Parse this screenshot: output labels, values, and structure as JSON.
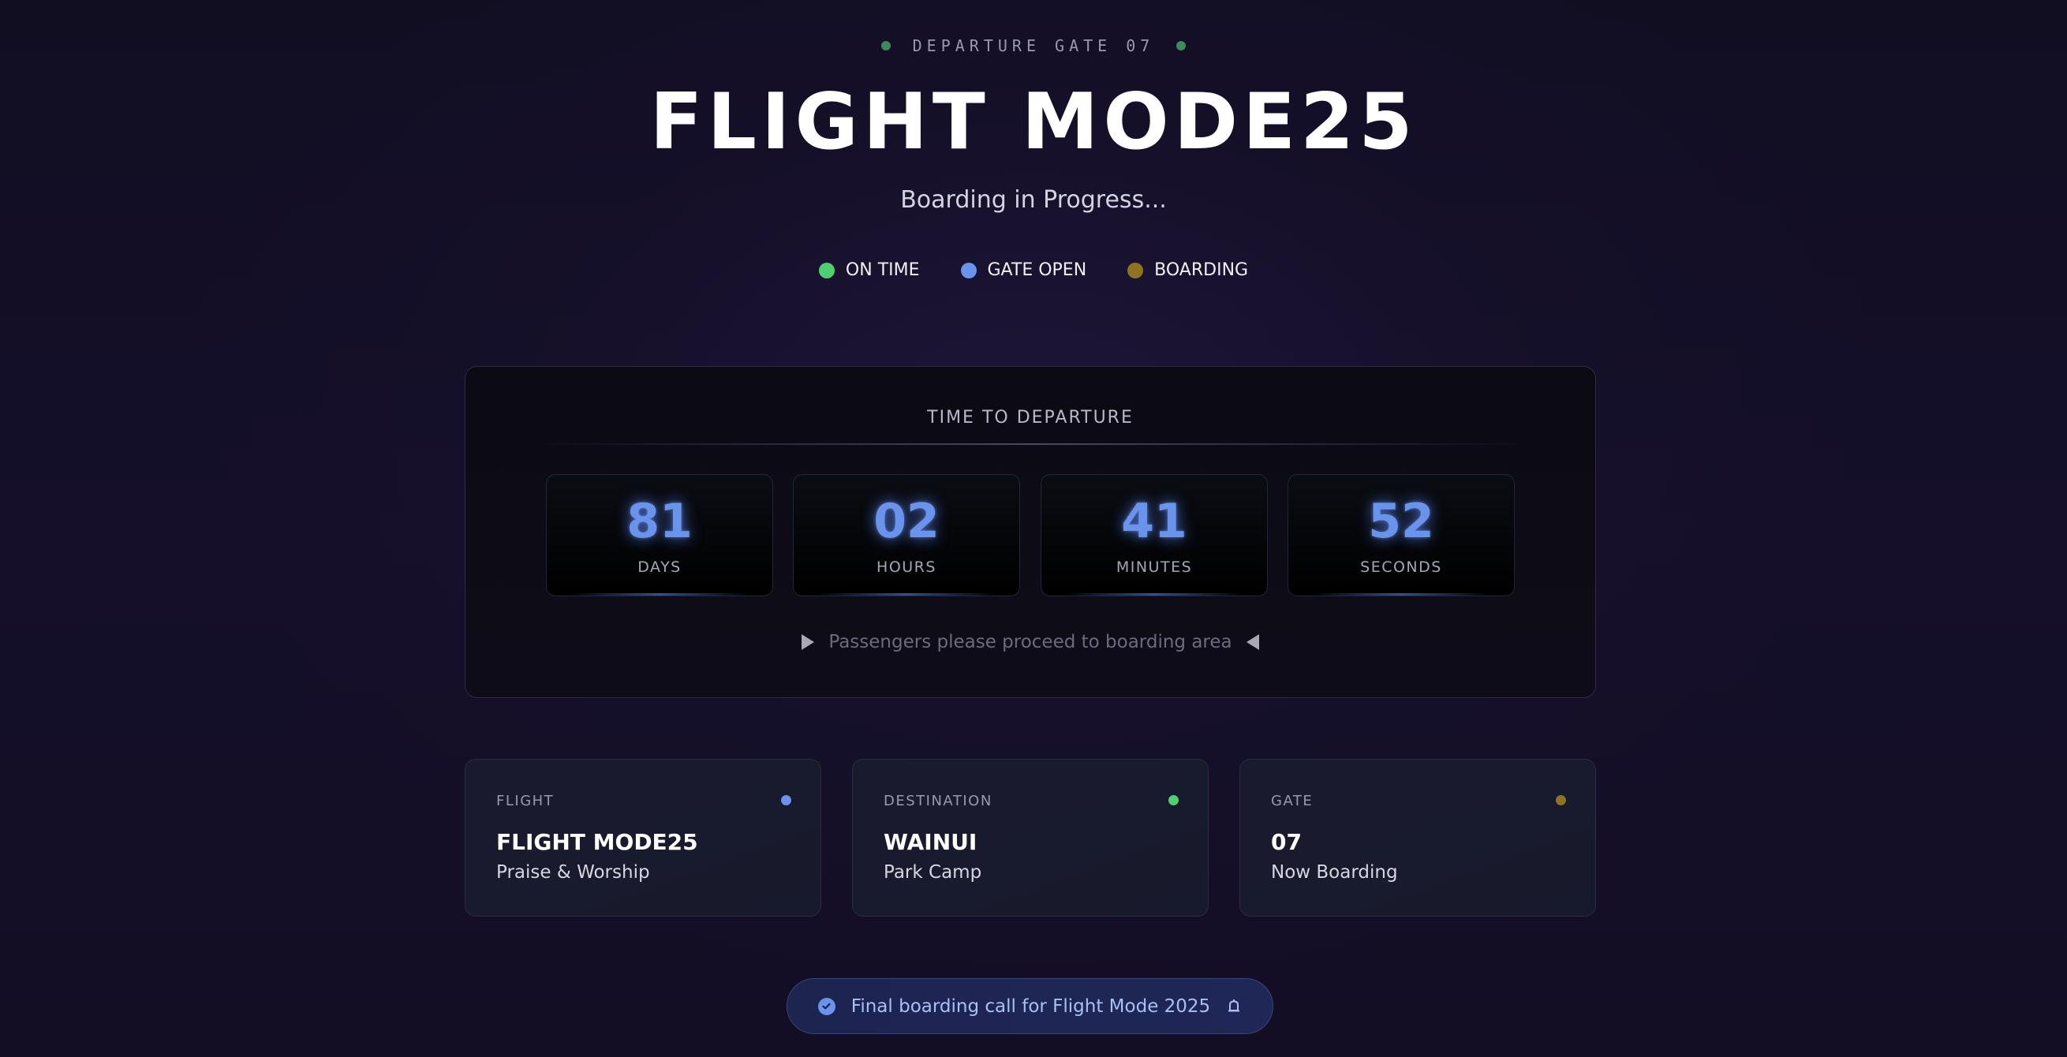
{
  "header": {
    "gate_label": "DEPARTURE GATE 07",
    "title": "FLIGHT MODE25",
    "subtitle": "Boarding in Progress..."
  },
  "statuses": [
    {
      "label": "ON TIME",
      "color": "#4fcf6f"
    },
    {
      "label": "GATE OPEN",
      "color": "#6a93ec"
    },
    {
      "label": "BOARDING",
      "color": "#8f7420"
    }
  ],
  "countdown": {
    "title": "TIME TO DEPARTURE",
    "units": [
      {
        "value": "81",
        "label": "DAYS"
      },
      {
        "value": "02",
        "label": "HOURS"
      },
      {
        "value": "41",
        "label": "MINUTES"
      },
      {
        "value": "52",
        "label": "SECONDS"
      }
    ],
    "message": "Passengers please proceed to boarding area"
  },
  "info_cards": [
    {
      "label": "FLIGHT",
      "main": "FLIGHT MODE25",
      "sub": "Praise & Worship",
      "dot_color": "#6a93ec"
    },
    {
      "label": "DESTINATION",
      "main": "WAINUI",
      "sub": "Park Camp",
      "dot_color": "#4fcf6f"
    },
    {
      "label": "GATE",
      "main": "07",
      "sub": "Now Boarding",
      "dot_color": "#8f7420"
    }
  ],
  "banner": {
    "text": "Final boarding call for Flight Mode 2025",
    "icons": [
      "check-circle-icon",
      "bell-icon"
    ]
  },
  "colors": {
    "accent_blue": "#6a93ec",
    "green": "#4fcf6f",
    "amber": "#8f7420"
  }
}
